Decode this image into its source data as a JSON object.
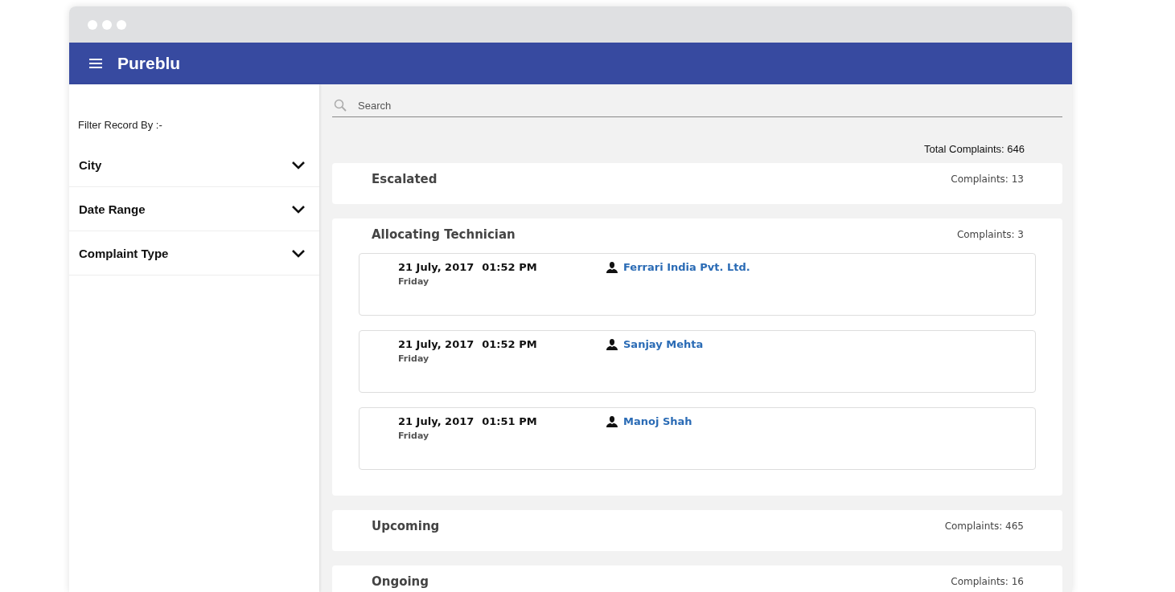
{
  "window": {
    "title": "Pureblu"
  },
  "sidebar": {
    "heading": "Filter Record By :-",
    "filters": [
      {
        "label": "City"
      },
      {
        "label": "Date Range"
      },
      {
        "label": "Complaint Type"
      }
    ]
  },
  "search": {
    "placeholder": "Search"
  },
  "total": "Total Complaints: 646",
  "sections": [
    {
      "title": "Escalated",
      "count": "Complaints: 13"
    },
    {
      "title": "Allocating Technician",
      "count": "Complaints: 3",
      "entries": [
        {
          "date": "21 July, 2017",
          "time": "01:52 PM",
          "day": "Friday",
          "customer": "Ferrari India Pvt. Ltd."
        },
        {
          "date": "21 July, 2017",
          "time": "01:52 PM",
          "day": "Friday",
          "customer": "Sanjay Mehta"
        },
        {
          "date": "21 July, 2017",
          "time": "01:51 PM",
          "day": "Friday",
          "customer": "Manoj Shah"
        }
      ]
    },
    {
      "title": "Upcoming",
      "count": "Complaints: 465"
    },
    {
      "title": "Ongoing",
      "count": "Complaints: 16"
    }
  ]
}
